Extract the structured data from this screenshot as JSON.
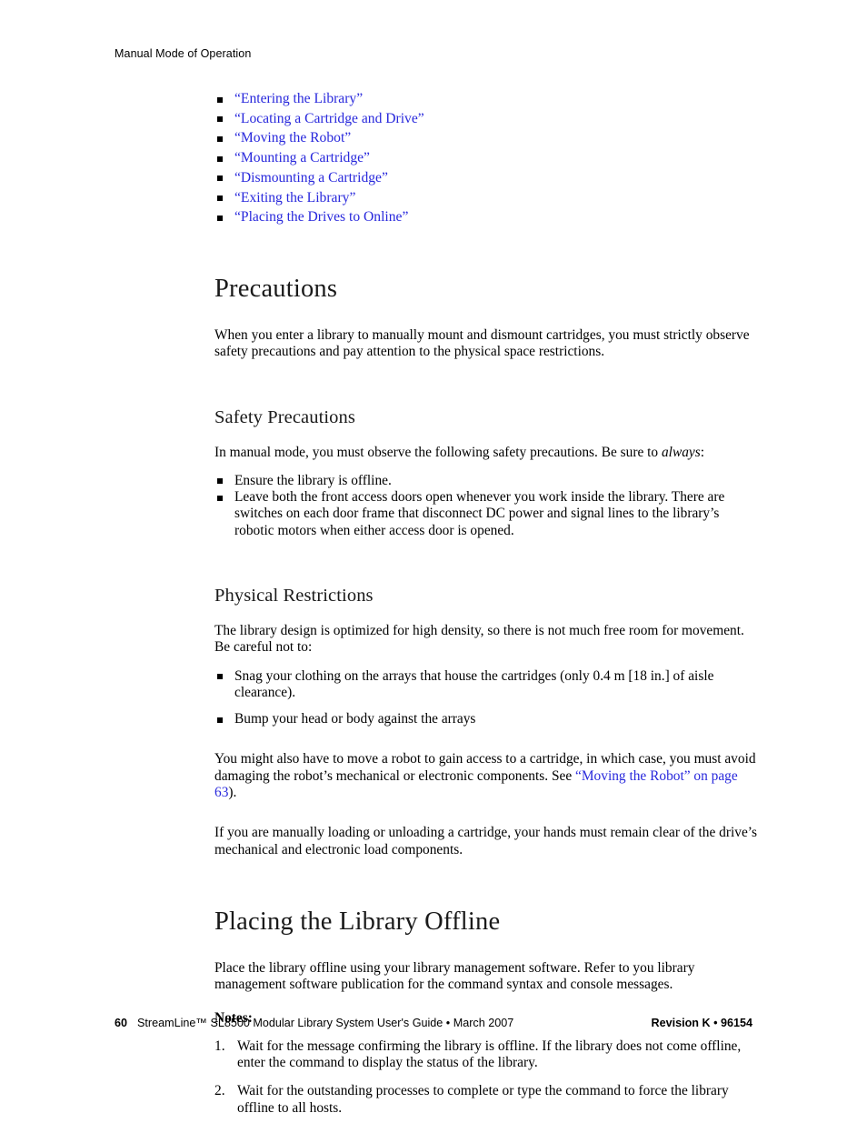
{
  "header": {
    "running_head": "Manual Mode of Operation"
  },
  "link_list": {
    "items": [
      "“Entering the Library”",
      "“Locating a Cartridge and Drive”",
      "“Moving the Robot”",
      "“Mounting a Cartridge”",
      "“Dismounting a Cartridge”",
      "“Exiting the Library”",
      "“Placing the Drives to Online”"
    ],
    "link_color": "#2828dc",
    "bullet": "black-square"
  },
  "precautions": {
    "heading": "Precautions",
    "intro": "When you enter a library to manually mount and dismount cartridges, you must strictly observe safety precautions and pay attention to the physical space restrictions.",
    "safety": {
      "heading": "Safety Precautions",
      "intro_before_italic": "In manual mode, you must observe the following safety precautions. Be sure to ",
      "intro_italic": "always",
      "intro_after_italic": ":",
      "bullets": [
        "Ensure the library is offline.",
        "Leave both the front access doors open whenever you work inside the library. There are switches on each door frame that disconnect DC power and signal lines to the library’s robotic motors when either access door is opened."
      ]
    },
    "physical": {
      "heading": "Physical Restrictions",
      "intro": "The library design is optimized for high density, so there is not much free room for movement. Be careful not to:",
      "bullets": [
        "Snag your clothing on the arrays that house the cartridges (only 0.4 m [18 in.] of aisle clearance).",
        "Bump your head or body against the arrays"
      ],
      "robot_para_before_link": "You might also have to move a robot to gain access to a cartridge, in which case, you must avoid damaging the robot’s mechanical or electronic components. See ",
      "robot_para_link": "“Moving the Robot” on page 63",
      "robot_para_after_link": ").",
      "loading_para": "If you are manually loading or unloading a cartridge, your hands must remain clear of the drive’s mechanical and electronic load components."
    }
  },
  "placing_offline": {
    "heading": "Placing the Library Offline",
    "intro": "Place the library offline using your library management software. Refer to you library management software publication for the command syntax and console messages.",
    "notes_label": "Notes:",
    "notes": [
      {
        "num": "1.",
        "text": "Wait for the message confirming the library is offline. If the library does not come offline, enter the command to display the status of the library."
      },
      {
        "num": "2.",
        "text": "Wait for the outstanding processes to complete or type the command to force the library offline to all hosts."
      }
    ]
  },
  "footer": {
    "page_number": "60",
    "publication": "StreamLine™ SL8500 Modular Library System User's Guide • March 2007",
    "revision": "Revision K • 96154"
  }
}
